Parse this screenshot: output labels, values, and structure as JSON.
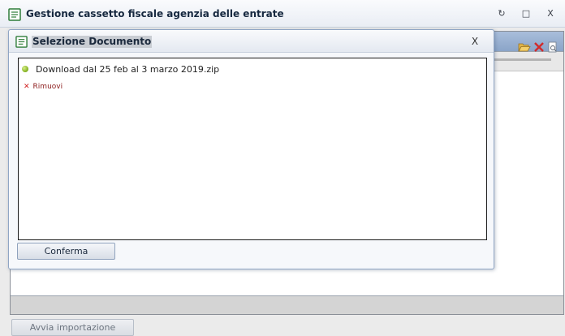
{
  "window": {
    "title": "Gestione cassetto fiscale agenzia delle entrate",
    "controls": {
      "refresh": "↻",
      "maximize": "□",
      "close": "X"
    },
    "icon": "document-list-icon"
  },
  "background": {
    "toolbar_icons": [
      "open-folder-icon",
      "delete-icon",
      "search-document-icon"
    ],
    "start_button": "Avvia importazione"
  },
  "dialog": {
    "title": "Selezione Documento",
    "icon": "document-list-icon",
    "close": "X",
    "file": {
      "name": "Download dal 25 feb al 3 marzo 2019.zip",
      "status_color": "#8cc63f"
    },
    "remove_label": "Rimuovi",
    "confirm_button": "Conferma"
  },
  "colors": {
    "accent": "#8aa4c8",
    "remove": "#d11f1f"
  }
}
